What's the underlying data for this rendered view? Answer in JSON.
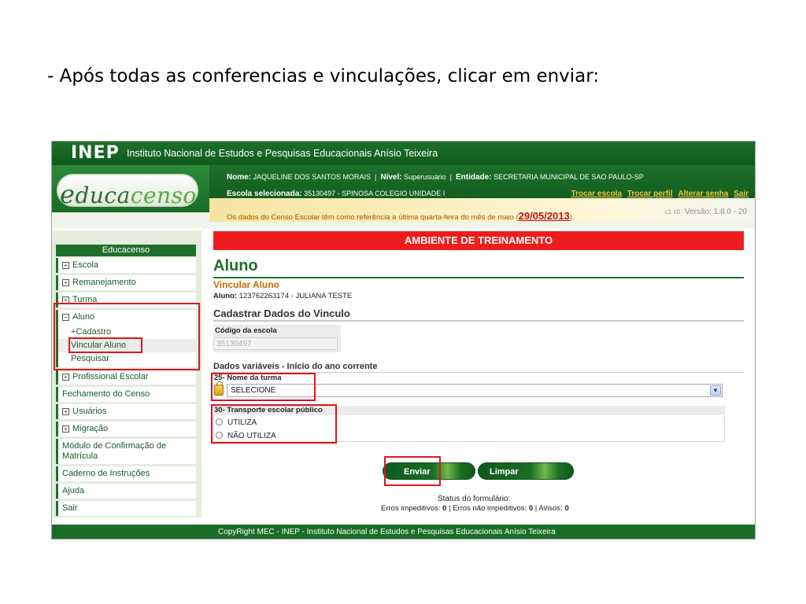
{
  "slide": {
    "title": "- Após todas as conferencias e vinculações, clicar em enviar:"
  },
  "header": {
    "inep_logo": "INEP",
    "institute": "Instituto Nacional de Estudos e Pesquisas Educacionais Anísio Teixeira",
    "app_logo_prefix": "e",
    "app_logo_mid": "duca",
    "app_logo_suffix": "censo",
    "nome_label": "Nome:",
    "nome_value": "JAQUELINE DOS SANTOS MORAIS",
    "nivel_label": "Nível:",
    "nivel_value": "Superusuário",
    "entidade_label": "Entidade:",
    "entidade_value": "SECRETARIA MUNICIPAL DE SAO PAULO-SP",
    "escola_label": "Escola selecionada:",
    "escola_value": "35130497 - SPINOSA COLEGIO UNIDADE I",
    "links": [
      "Trocar escola",
      "Trocar perfil",
      "Alterar senha",
      "Sair"
    ],
    "censo_note_prefix": "Os dados do Censo Escolar têm como referência a última quarta-feira do mês de maio (",
    "censo_date": "29/05/2013",
    "censo_note_suffix": ").",
    "version_tiny": "c1 c0",
    "version": "Versão: 1.8.0 - 20"
  },
  "sidebar": {
    "title": "Educacenso",
    "items": [
      {
        "label": "Escola",
        "expandable": true
      },
      {
        "label": "Remanejamento",
        "expandable": true
      },
      {
        "label": "Turma",
        "expandable": true
      }
    ],
    "aluno": {
      "label": "Aluno",
      "children": [
        {
          "label": "Cadastro",
          "expandable": true
        },
        {
          "label": "Vincular Aluno",
          "active": true
        },
        {
          "label": "Pesquisar"
        }
      ]
    },
    "items_after": [
      {
        "label": "Profissional Escolar",
        "expandable": true
      },
      {
        "label": "Fechamento do Censo",
        "expandable": false
      },
      {
        "label": "Usuários",
        "expandable": true
      },
      {
        "label": "Migração",
        "expandable": true
      },
      {
        "label": "Módulo de Confirmação de Matrícula",
        "expandable": false
      },
      {
        "label": "Caderno de Instruções",
        "expandable": false
      },
      {
        "label": "Ajuda",
        "expandable": false
      },
      {
        "label": "Sair",
        "expandable": false
      }
    ]
  },
  "main": {
    "training_banner": "AMBIENTE DE TREINAMENTO",
    "page_title": "Aluno",
    "subtitle": "Vincular Aluno",
    "aluno_label": "Aluno:",
    "aluno_value": "123762263174 - JULIANA TESTE",
    "section_title": "Cadastrar Dados do Vinculo",
    "codigo_label": "Código da escola",
    "codigo_value": "35130497",
    "vars_title": "Dados variáveis - Início do ano corrente",
    "turma_label": "25- Nome da turma",
    "turma_selected": "SELECIONE",
    "transporte_label": "30- Transporte escolar público",
    "transporte_options": [
      "UTILIZA",
      "NÃO UTILIZA"
    ],
    "enviar_label": "Enviar",
    "limpar_label": "Limpar",
    "status_title": "Status do formulário:",
    "erros_imp_label": "Erros impeditivos:",
    "erros_imp_value": "0",
    "erros_nao_label": "Erros não impeditivos:",
    "erros_nao_value": "0",
    "avisos_label": "Avisos:",
    "avisos_value": "0"
  },
  "footer": {
    "text": "CopyRight MEC - INEP - Instituto Nacional de Estudos e Pesquisas Educacionais Anísio Teixeira"
  },
  "colors": {
    "brand_green": "#1f6f2a",
    "training_red": "#ee1c1c",
    "highlight_red": "#e0141e",
    "link_yellow": "#f4c542"
  }
}
